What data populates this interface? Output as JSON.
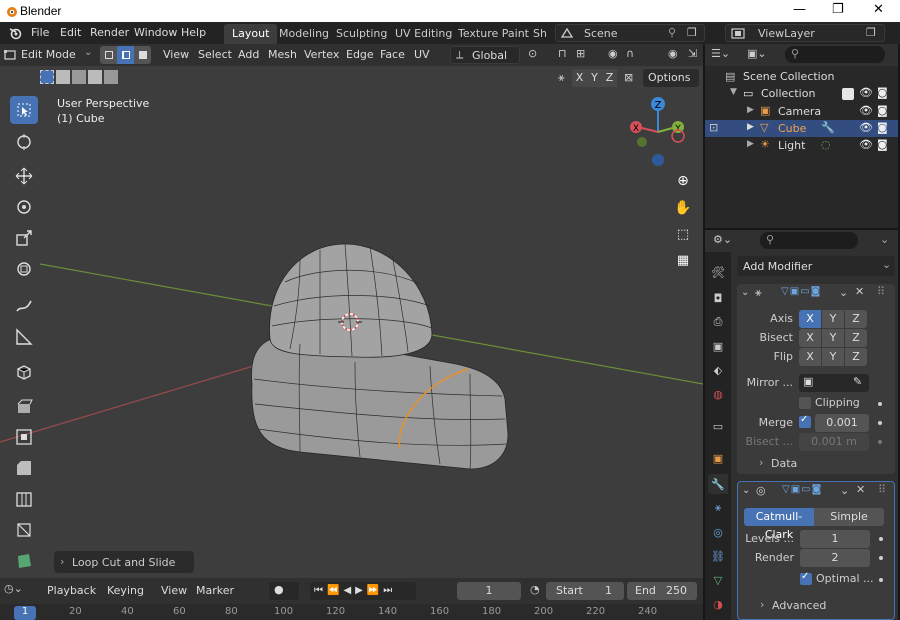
{
  "window": {
    "title": "Blender",
    "minimize": "—",
    "maximize": "❐",
    "close": "✕"
  },
  "menus": [
    "File",
    "Edit",
    "Render",
    "Window",
    "Help"
  ],
  "workspaces": [
    {
      "label": "Layout",
      "active": true
    },
    {
      "label": "Modeling"
    },
    {
      "label": "Sculpting"
    },
    {
      "label": "UV Editing"
    },
    {
      "label": "Texture Paint"
    },
    {
      "label": "Sh"
    }
  ],
  "scene": "Scene",
  "view_layer": "ViewLayer",
  "viewport": {
    "mode": "Edit Mode",
    "header_menus": [
      "View",
      "Select",
      "Add",
      "Mesh",
      "Vertex",
      "Edge",
      "Face",
      "UV"
    ],
    "transform_orientation": "Global",
    "options_label": "Options",
    "axis_x": "X",
    "axis_y": "Y",
    "axis_z": "Z",
    "overlay_line1": "User Perspective",
    "overlay_line2": "(1) Cube",
    "last_operator": "Loop Cut and Slide"
  },
  "timeline": {
    "menus": [
      "Playback",
      "Keying",
      "View",
      "Marker"
    ],
    "current_frame": "1",
    "start_label": "Start",
    "start_value": "1",
    "end_label": "End",
    "end_value": "250",
    "ruler": [
      "1",
      "20",
      "40",
      "60",
      "80",
      "100",
      "120",
      "140",
      "160",
      "180",
      "200",
      "220",
      "240"
    ]
  },
  "outliner": {
    "root": "Scene Collection",
    "collection": "Collection",
    "items": [
      {
        "label": "Camera",
        "selected": false
      },
      {
        "label": "Cube",
        "selected": true
      },
      {
        "label": "Light",
        "selected": false
      }
    ]
  },
  "properties": {
    "add_modifier": "Add Modifier",
    "mirror": {
      "axis_label": "Axis",
      "bisect_label": "Bisect",
      "flip_label": "Flip",
      "mirror_object_label": "Mirror ...",
      "clipping_label": "Clipping",
      "merge_label": "Merge",
      "merge_value": "0.001",
      "bisect_dist_label": "Bisect ...",
      "bisect_dist_value": "0.001 m",
      "data_label": "Data"
    },
    "subsurf": {
      "catmull": "Catmull-Clark",
      "simple": "Simple",
      "levels_label": "Levels ...",
      "levels_value": "1",
      "render_label": "Render",
      "render_value": "2",
      "optimal_label": "Optimal ...",
      "advanced_label": "Advanced"
    }
  },
  "colors": {
    "accent": "#4772b3",
    "x_axis": "#d6505a",
    "y_axis": "#82b23c",
    "z_axis": "#3b87d9"
  }
}
